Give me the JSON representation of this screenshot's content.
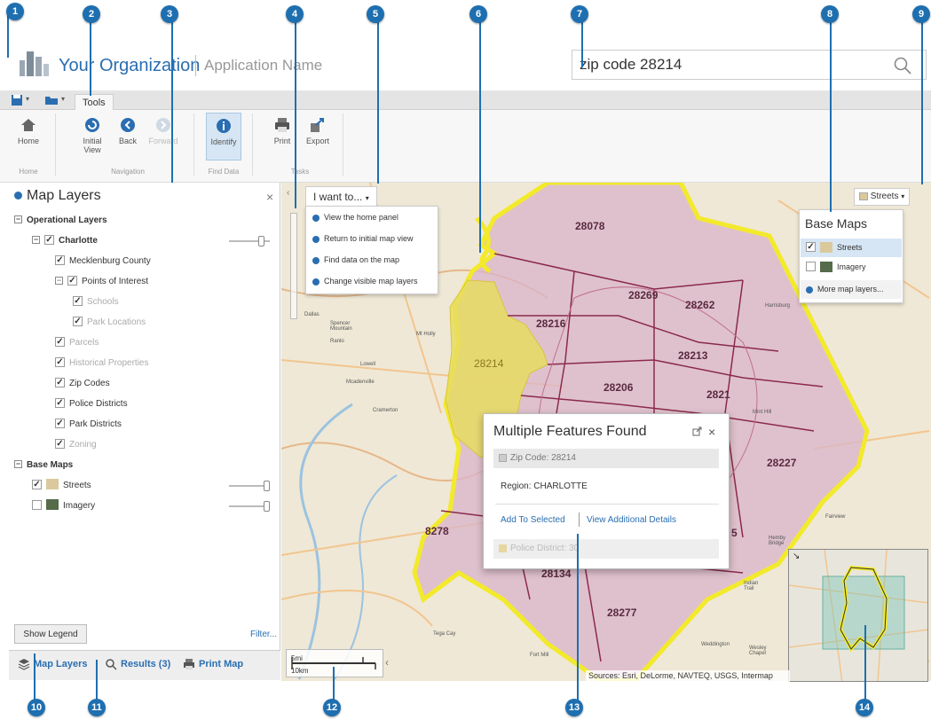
{
  "header": {
    "org_name": "Your Organization",
    "app_name": "Application Name",
    "search_value": "zip code 28214"
  },
  "toolbar": {
    "tab_label": "Tools",
    "buttons": {
      "home": "Home",
      "initial_view": "Initial View",
      "back": "Back",
      "forward": "Forward",
      "identify": "Identify",
      "print": "Print",
      "export": "Export"
    },
    "groups": {
      "home": "Home",
      "navigation": "Navigation",
      "find_data": "Find Data",
      "tasks": "Tasks"
    }
  },
  "layers_panel": {
    "title": "Map Layers",
    "close": "×",
    "items": [
      {
        "label": "Operational Layers",
        "level": 0,
        "type": "group",
        "bold": true
      },
      {
        "label": "Charlotte",
        "level": 1,
        "type": "layer",
        "bold": true,
        "checked": true,
        "expander": true,
        "slider": true,
        "opacity": 0.85
      },
      {
        "label": "Mecklenburg County",
        "level": 2,
        "type": "layer",
        "checked": true
      },
      {
        "label": "Points of Interest",
        "level": 2,
        "type": "layer",
        "checked": true,
        "expander": true
      },
      {
        "label": "Schools",
        "level": 3,
        "type": "layer",
        "checked": true,
        "muted": true
      },
      {
        "label": "Park Locations",
        "level": 3,
        "type": "layer",
        "checked": true,
        "muted": true
      },
      {
        "label": "Parcels",
        "level": 2,
        "type": "layer",
        "checked": true,
        "muted": true
      },
      {
        "label": "Historical Properties",
        "level": 2,
        "type": "layer",
        "checked": true,
        "muted": true
      },
      {
        "label": "Zip Codes",
        "level": 2,
        "type": "layer",
        "checked": true
      },
      {
        "label": "Police Districts",
        "level": 2,
        "type": "layer",
        "checked": true
      },
      {
        "label": "Park Districts",
        "level": 2,
        "type": "layer",
        "checked": true
      },
      {
        "label": "Zoning",
        "level": 2,
        "type": "layer",
        "checked": true,
        "muted": true
      },
      {
        "label": "Base Maps",
        "level": 0,
        "type": "group",
        "bold": true
      },
      {
        "label": "Streets",
        "level": 1,
        "type": "basemap",
        "checked": true,
        "slider": true,
        "opacity": 1.0,
        "thumb": "streets"
      },
      {
        "label": "Imagery",
        "level": 1,
        "type": "basemap",
        "checked": false,
        "slider": true,
        "opacity": 1.0,
        "thumb": "imagery"
      }
    ],
    "show_legend": "Show Legend",
    "filter": "Filter..."
  },
  "bottom_tabs": {
    "map_layers": "Map Layers",
    "results": "Results (3)",
    "print_map": "Print Map"
  },
  "i_want_to": {
    "button": "I want to...",
    "items": [
      "View the home panel",
      "Return to initial map view",
      "Find data on the map",
      "Change visible map layers"
    ]
  },
  "basemaps": {
    "button": "Streets",
    "title": "Base Maps",
    "items": [
      {
        "label": "Streets",
        "checked": true
      },
      {
        "label": "Imagery",
        "checked": false
      },
      {
        "label": "More map layers..."
      }
    ]
  },
  "popup": {
    "title": "Multiple Features Found",
    "section1": "Zip Code: 28214",
    "region": "Region: CHARLOTTE",
    "add_to_selected": "Add To Selected",
    "view_details": "View Additional Details",
    "section2": "Police District: 30"
  },
  "map": {
    "zip_labels": [
      "28078",
      "28269",
      "28262",
      "28216",
      "28214",
      "28213",
      "28206",
      "2821",
      "28227",
      "8278",
      "28134",
      "28277",
      "5"
    ],
    "places": [
      "Dallas",
      "Spencer Mountain",
      "Ranlo",
      "Mt Holly",
      "Lowell",
      "Mcadenville",
      "Cramerton",
      "Harrisburg",
      "Mint Hill",
      "Fairview",
      "Hemby Bridge",
      "Indian Trail",
      "Weddington",
      "Wesley Chapel",
      "Fort Mill",
      "Tega Cay"
    ],
    "scale_top": "5mi",
    "scale_bottom": "10km",
    "attribution": "Sources: Esri, DeLorme, NAVTEQ, USGS, Intermap"
  },
  "callouts": [
    "1",
    "2",
    "3",
    "4",
    "5",
    "6",
    "7",
    "8",
    "9",
    "10",
    "11",
    "12",
    "13",
    "14"
  ],
  "colors": {
    "accent": "#2a6eb1",
    "callout": "#1e6fb0",
    "zip_fill": "#d9b4c9",
    "selected_zip": "#e8dc60",
    "county_outline": "#f2ea2a"
  }
}
